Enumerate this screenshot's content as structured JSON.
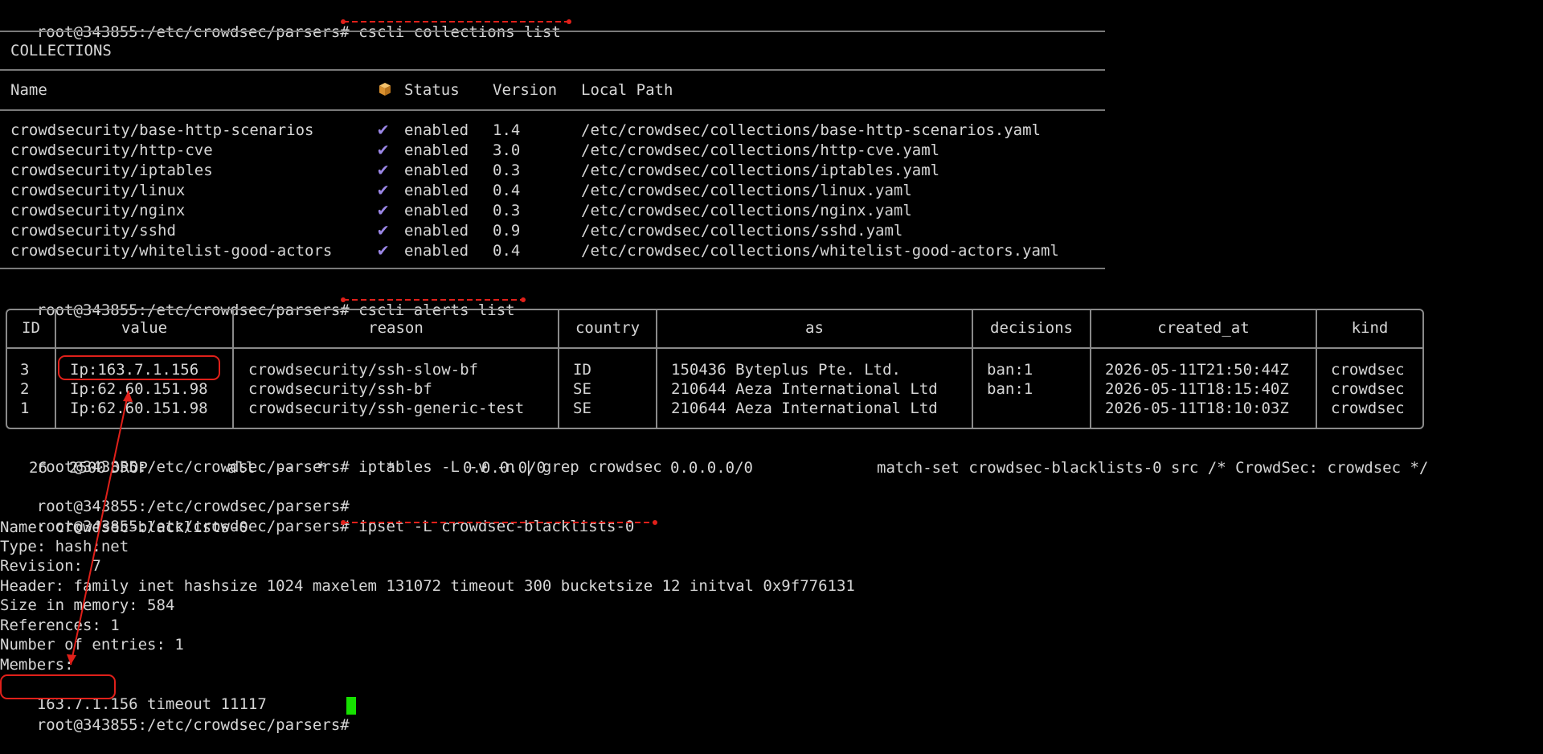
{
  "prompt": "root@343855:/etc/crowdsec/parsers#",
  "commands": {
    "collections": "cscli collections list",
    "alerts": "cscli alerts list",
    "iptables": "iptables -L -v -n | grep crowdsec",
    "ipset": "ipset -L crowdsec-blacklists-0"
  },
  "collections_table": {
    "title": "COLLECTIONS",
    "headers": {
      "name": "Name",
      "status": "Status",
      "version": "Version",
      "path": "Local Path"
    },
    "rows": [
      {
        "name": "crowdsecurity/base-http-scenarios",
        "status": "enabled",
        "version": "1.4",
        "path": "/etc/crowdsec/collections/base-http-scenarios.yaml"
      },
      {
        "name": "crowdsecurity/http-cve",
        "status": "enabled",
        "version": "3.0",
        "path": "/etc/crowdsec/collections/http-cve.yaml"
      },
      {
        "name": "crowdsecurity/iptables",
        "status": "enabled",
        "version": "0.3",
        "path": "/etc/crowdsec/collections/iptables.yaml"
      },
      {
        "name": "crowdsecurity/linux",
        "status": "enabled",
        "version": "0.4",
        "path": "/etc/crowdsec/collections/linux.yaml"
      },
      {
        "name": "crowdsecurity/nginx",
        "status": "enabled",
        "version": "0.3",
        "path": "/etc/crowdsec/collections/nginx.yaml"
      },
      {
        "name": "crowdsecurity/sshd",
        "status": "enabled",
        "version": "0.9",
        "path": "/etc/crowdsec/collections/sshd.yaml"
      },
      {
        "name": "crowdsecurity/whitelist-good-actors",
        "status": "enabled",
        "version": "0.4",
        "path": "/etc/crowdsec/collections/whitelist-good-actors.yaml"
      }
    ]
  },
  "alerts_table": {
    "headers": {
      "id": "ID",
      "value": "value",
      "reason": "reason",
      "country": "country",
      "as": "as",
      "decisions": "decisions",
      "created_at": "created_at",
      "kind": "kind"
    },
    "rows": [
      {
        "id": "3",
        "value": "Ip:163.7.1.156",
        "reason": "crowdsecurity/ssh-slow-bf",
        "country": "ID",
        "as": "150436 Byteplus Pte. Ltd.",
        "decisions": "ban:1",
        "created_at": "2026-05-11T21:50:44Z",
        "kind": "crowdsec"
      },
      {
        "id": "2",
        "value": "Ip:62.60.151.98",
        "reason": "crowdsecurity/ssh-bf",
        "country": "SE",
        "as": "210644 Aeza International Ltd",
        "decisions": "ban:1",
        "created_at": "2026-05-11T18:15:40Z",
        "kind": "crowdsec"
      },
      {
        "id": "1",
        "value": "Ip:62.60.151.98",
        "reason": "crowdsecurity/ssh-generic-test",
        "country": "SE",
        "as": "210644 Aeza International Ltd",
        "decisions": "",
        "created_at": "2026-05-11T18:10:03Z",
        "kind": "crowdsec"
      }
    ]
  },
  "iptables_output": {
    "pkts": "26",
    "bytes": "2500",
    "target": "DROP",
    "prot": "all",
    "opt": "--",
    "in": "*",
    "out": "*",
    "source": "0.0.0.0/0",
    "destination": "0.0.0.0/0",
    "extra": "match-set crowdsec-blacklists-0 src /* CrowdSec: crowdsec */"
  },
  "ipset_output": [
    "Name: crowdsec-blacklists-0",
    "Type: hash:net",
    "Revision: 7",
    "Header: family inet hashsize 1024 maxelem 131072 timeout 300 bucketsize 12 initval 0x9f776131",
    "Size in memory: 584",
    "References: 1",
    "Number of entries: 1",
    "Members:"
  ],
  "member": {
    "ip": "163.7.1.156",
    "timeout": " timeout 11117"
  },
  "colors": {
    "background": "#000000",
    "text": "#d6d6d6",
    "table_border": "#8a8a8a",
    "check": "#9b86e6",
    "annotation": "#e0201a",
    "cursor": "#16e000"
  },
  "icons": {
    "status_header": "package-icon",
    "status_row": "check-icon"
  }
}
